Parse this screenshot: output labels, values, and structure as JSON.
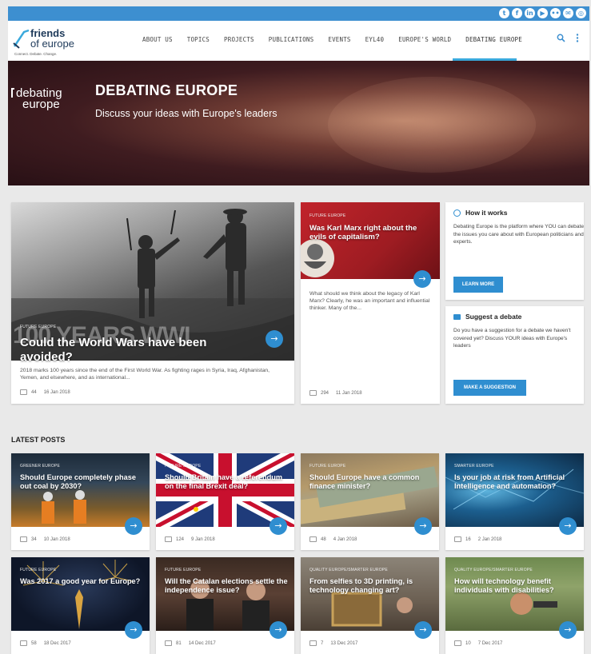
{
  "social": {
    "icons": [
      "twitter-icon",
      "facebook-icon",
      "linkedin-icon",
      "youtube-icon",
      "flickr-icon",
      "email-icon",
      "instagram-icon"
    ]
  },
  "header": {
    "logo_line1": "friends",
    "logo_line2": "of europe",
    "logo_tagline": "Connect. Debate. Change.",
    "nav": [
      "ABOUT US",
      "TOPICS",
      "PROJECTS",
      "PUBLICATIONS",
      "EVENTS",
      "EYL40",
      "EUROPE'S WORLD",
      "DEBATING EUROPE"
    ],
    "active_nav": "DEBATING EUROPE"
  },
  "hero": {
    "logo_line1": "debating",
    "logo_line2": "europe",
    "title": "DEBATING EUROPE",
    "subtitle": "Discuss your ideas with Europe's leaders"
  },
  "featured": {
    "category": "FUTURE EUROPE",
    "overlay_text": "100 YEARS WWI",
    "title": "Could the World Wars have been avoided?",
    "excerpt": "2018 marks 100 years since the end of the First World War. As fighting rages in Syria, Iraq, Afghanistan, Yemen, and elsewhere, and as international...",
    "comments": "44",
    "date": "16 Jan 2018"
  },
  "second": {
    "category": "FUTURE EUROPE",
    "title": "Was Karl Marx right about the evils of capitalism?",
    "excerpt": "What should we think about the legacy of Karl Marx? Clearly, he was an important and influential thinker. Many of the...",
    "comments": "294",
    "date": "11 Jan 2018"
  },
  "how_it_works": {
    "title": "How it works",
    "text": "Debating Europe is the platform where YOU can debate the issues you care about with European politicians and experts.",
    "button": "LEARN MORE"
  },
  "suggest": {
    "title": "Suggest a debate",
    "text": "Do you have a suggestion for a debate we haven't covered yet? Discuss YOUR ideas with Europe's leaders",
    "button": "MAKE A SUGGESTION"
  },
  "latest_heading": "LATEST POSTS",
  "posts": [
    {
      "category": "GREENER EUROPE",
      "title": "Should Europe completely phase out coal by 2030?",
      "comments": "34",
      "date": "10 Jan 2018"
    },
    {
      "category": "FUTURE EUROPE",
      "title": "Should Britain have a referendum on the final Brexit deal?",
      "comments": "124",
      "date": "9 Jan 2018"
    },
    {
      "category": "FUTURE EUROPE",
      "title": "Should Europe have a common finance minister?",
      "comments": "48",
      "date": "4 Jan 2018"
    },
    {
      "category": "SMARTER EUROPE",
      "title": "Is your job at risk from Artificial Intelligence and automation?",
      "comments": "16",
      "date": "2 Jan 2018"
    },
    {
      "category": "FUTURE EUROPE",
      "title": "Was 2017 a good year for Europe?",
      "comments": "58",
      "date": "18 Dec 2017"
    },
    {
      "category": "FUTURE EUROPE",
      "title": "Will the Catalan elections settle the independence issue?",
      "comments": "81",
      "date": "14 Dec 2017"
    },
    {
      "category": "QUALITY EUROPE/SMARTER EUROPE",
      "title": "From selfies to 3D printing, is technology changing art?",
      "comments": "7",
      "date": "13 Dec 2017"
    },
    {
      "category": "QUALITY EUROPE/SMARTER EUROPE",
      "title": "How will technology benefit individuals with disabilities?",
      "comments": "10",
      "date": "7 Dec 2017"
    }
  ],
  "colors": {
    "accent": "#2f8ed0",
    "topbar": "#3d8fd0",
    "logo_navy": "#1e3a5a"
  }
}
